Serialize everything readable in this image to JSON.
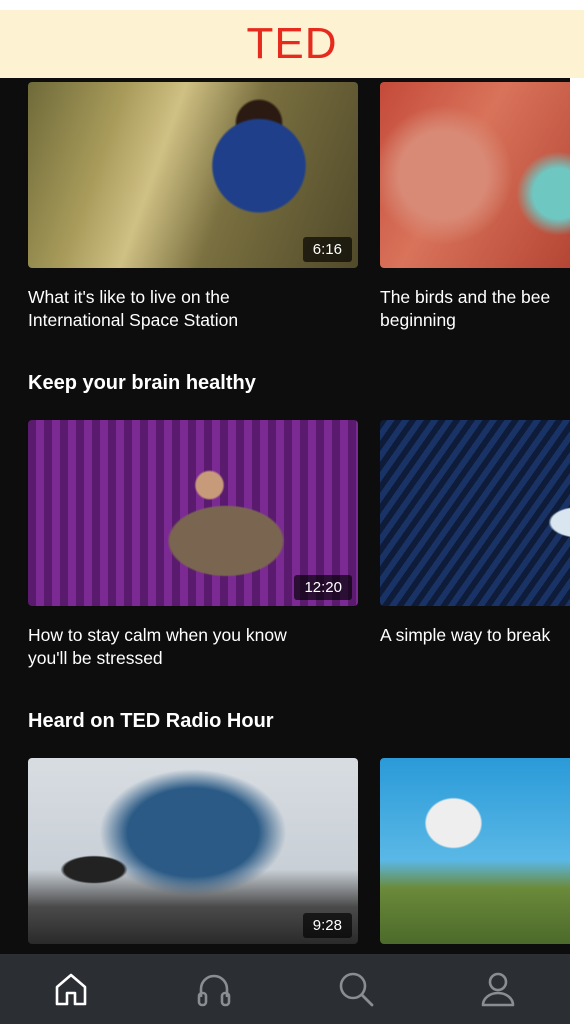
{
  "header": {
    "title": "TED"
  },
  "rows": [
    {
      "cards": [
        {
          "caption": "What it's like to live on the\nInternational Space Station",
          "duration": "6:16"
        },
        {
          "caption": "The birds and the bee\nbeginning"
        }
      ]
    },
    {
      "section_title": "Keep your brain healthy",
      "cards": [
        {
          "caption": "How to stay calm when you know\nyou'll be stressed",
          "duration": "12:20"
        },
        {
          "caption": "A simple way to break"
        }
      ]
    },
    {
      "section_title": "Heard on TED Radio Hour",
      "cards": [
        {
          "duration": "9:28"
        },
        {}
      ]
    }
  ],
  "tabbar": {
    "items": [
      {
        "icon": "home-icon",
        "active": true
      },
      {
        "icon": "headphones-icon",
        "active": false
      },
      {
        "icon": "search-icon",
        "active": false
      },
      {
        "icon": "profile-icon",
        "active": false
      }
    ]
  },
  "colors": {
    "brand": "#e62b1e",
    "header_bg": "#fdf2d2",
    "feed_bg": "#0d0d0d",
    "tabbar_bg": "#2b2e33"
  }
}
